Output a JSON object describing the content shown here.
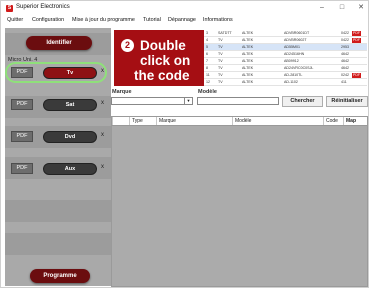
{
  "window": {
    "title": "Superior Electronics",
    "controls": [
      "–",
      "□",
      "✕"
    ]
  },
  "menu": [
    "Quitter",
    "Configuration",
    "Mise à jour du programme",
    "Tutorial",
    "Dépannage",
    "Informations"
  ],
  "sidebar": {
    "identify_label": "Identifier",
    "micro_label": "Micro Uni. 4",
    "devices": [
      {
        "pdf": "PDF",
        "label": "Tv",
        "x": "x"
      },
      {
        "pdf": "PDF",
        "label": "Sat",
        "x": "x"
      },
      {
        "pdf": "PDF",
        "label": "Dvd",
        "x": "x"
      },
      {
        "pdf": "PDF",
        "label": "Aux",
        "x": "x"
      }
    ],
    "program_label": "Programme"
  },
  "banner": {
    "number": "2",
    "line1": "Double",
    "line2": "click on",
    "line3": "the code"
  },
  "code_table": {
    "rows": [
      [
        "3",
        "SATDTT",
        "ALTEK",
        "ADVBR0601DT",
        "0422",
        "PDF"
      ],
      [
        "4",
        "TV",
        "ALTEK",
        "ADVBR0602T",
        "0422",
        "PDF"
      ],
      [
        "5",
        "TV",
        "ALTEK",
        "AD55M01",
        "2953",
        ""
      ],
      [
        "6",
        "TV",
        "ALTEK",
        "AD24516HN",
        "4642",
        ""
      ],
      [
        "7",
        "TV",
        "ALTEK",
        "AB09912",
        "4642",
        ""
      ],
      [
        "8",
        "TV",
        "ALTEK",
        "AD24VRC0C0SJL",
        "4642",
        ""
      ],
      [
        "11",
        "TV",
        "ALTEK",
        "AD-2810TL",
        "0242",
        "PDF"
      ],
      [
        "12",
        "TV",
        "ALTEK",
        "AD-1102",
        "411",
        ""
      ]
    ]
  },
  "search": {
    "brand_label": "Marque",
    "model_label": "Modèle",
    "search_button": "Chercher",
    "reset_button": "Réinitialiser"
  },
  "results": {
    "columns": [
      "Type",
      "Marque",
      "Modèle",
      "Code",
      "Map"
    ]
  },
  "colors": {
    "accent": "#8e1114",
    "banner": "#a50e13",
    "highlight": "#8fe07a"
  }
}
